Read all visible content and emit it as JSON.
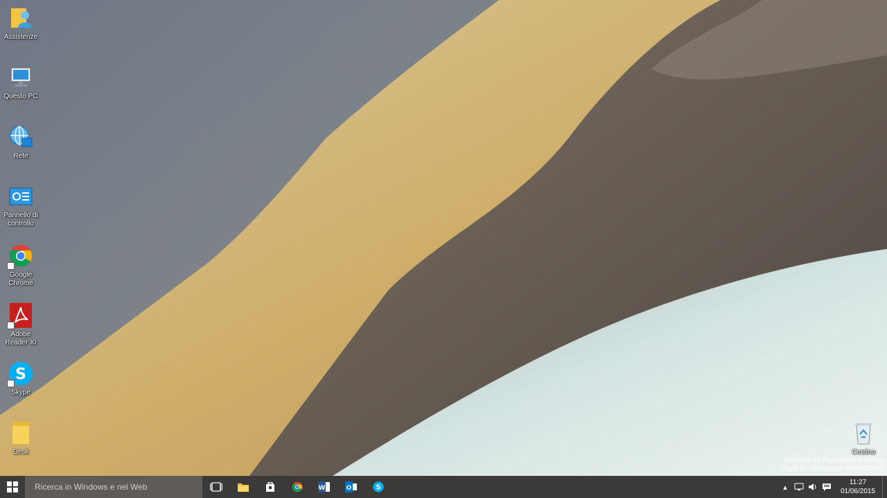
{
  "desktop_icons": [
    {
      "label": "Assistenze",
      "icon": "user-folder-icon"
    },
    {
      "label": "Questo PC",
      "icon": "computer-icon"
    },
    {
      "label": "Rete",
      "icon": "network-icon"
    },
    {
      "label": "Pannello di controllo",
      "icon": "control-panel-icon"
    },
    {
      "label": "Google Chrome",
      "icon": "chrome-icon"
    },
    {
      "label": "Adobe Reader XI",
      "icon": "adobe-reader-icon"
    },
    {
      "label": "Skype",
      "icon": "skype-icon"
    },
    {
      "label": "Desk",
      "icon": "folder-icon"
    },
    {
      "label": "Cestino",
      "icon": "recycle-bin-icon"
    }
  ],
  "watermark": {
    "line1": "Windows 10 Pro Insider Preview",
    "line2": "Copia di valutazione. Build 10074"
  },
  "taskbar": {
    "search_placeholder": "Ricerca in Windows e nel Web",
    "pinned": [
      {
        "name": "task-view",
        "icon": "task-view-icon"
      },
      {
        "name": "file-explorer",
        "icon": "folder-icon"
      },
      {
        "name": "store",
        "icon": "store-icon"
      },
      {
        "name": "chrome",
        "icon": "chrome-icon"
      },
      {
        "name": "word",
        "icon": "word-icon"
      },
      {
        "name": "outlook",
        "icon": "outlook-icon"
      },
      {
        "name": "skype",
        "icon": "skype-icon"
      }
    ],
    "clock": {
      "time": "11:27",
      "date": "01/06/2015"
    }
  },
  "colors": {
    "taskbar": "#3c3a39",
    "search_box": "#5e5b58",
    "accent_blue": "#1e88d8"
  }
}
